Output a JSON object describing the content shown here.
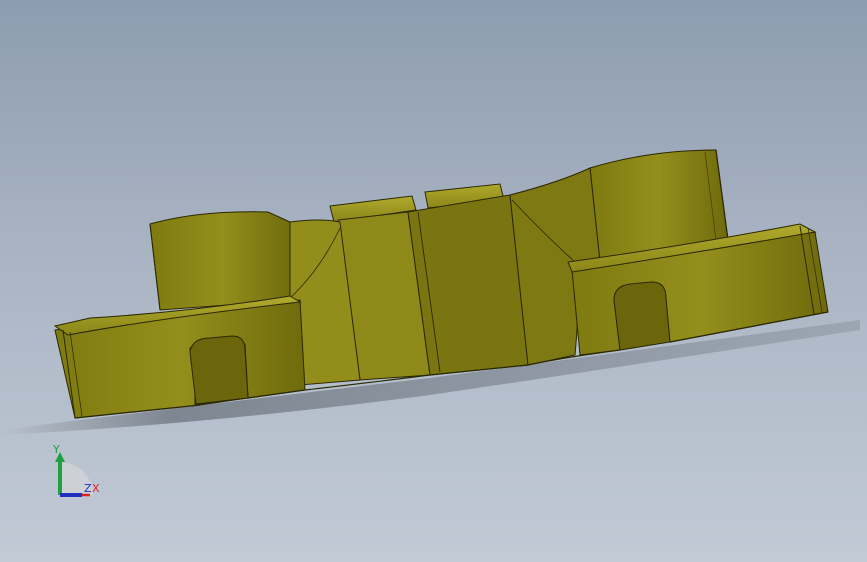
{
  "viewport": {
    "background_top": "#8d9cb0",
    "background_bottom": "#c2cad6",
    "model_color": "#8a8518",
    "model_highlight": "#a8a224",
    "model_shadow": "#5e5a0c"
  },
  "triad": {
    "x_label": "X",
    "y_label": "Y",
    "z_label": "Z",
    "x_color": "#e02020",
    "y_color": "#20a040",
    "z_color": "#2030c0"
  }
}
